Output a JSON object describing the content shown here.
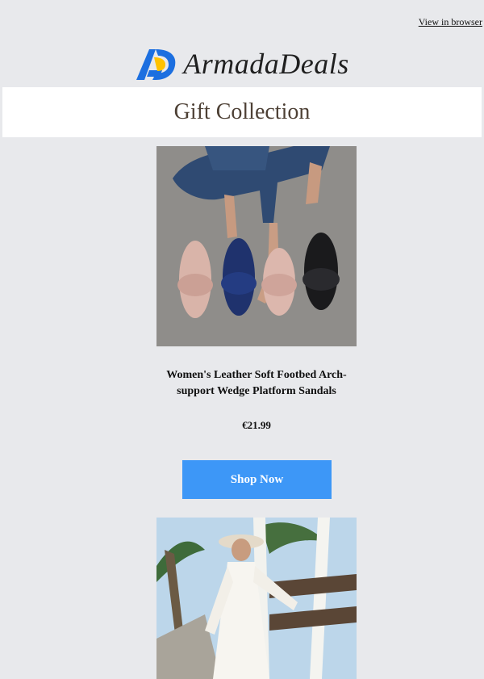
{
  "header": {
    "view_in_browser": "View in browser",
    "brand_name": "ArmadaDeals",
    "logo_icon": "armadadeals-logo-icon"
  },
  "banner": {
    "title": "Gift Collection"
  },
  "products": [
    {
      "image_icon": "sandals-photo",
      "name": "Women's Leather Soft Footbed Arch-support Wedge Platform Sandals",
      "price": "€21.99",
      "cta": "Shop Now"
    },
    {
      "image_icon": "lace-dress-photo"
    }
  ],
  "colors": {
    "background": "#e8e9ec",
    "accent": "#3d97f7",
    "band": "#ffffff",
    "title": "#4d4035"
  }
}
